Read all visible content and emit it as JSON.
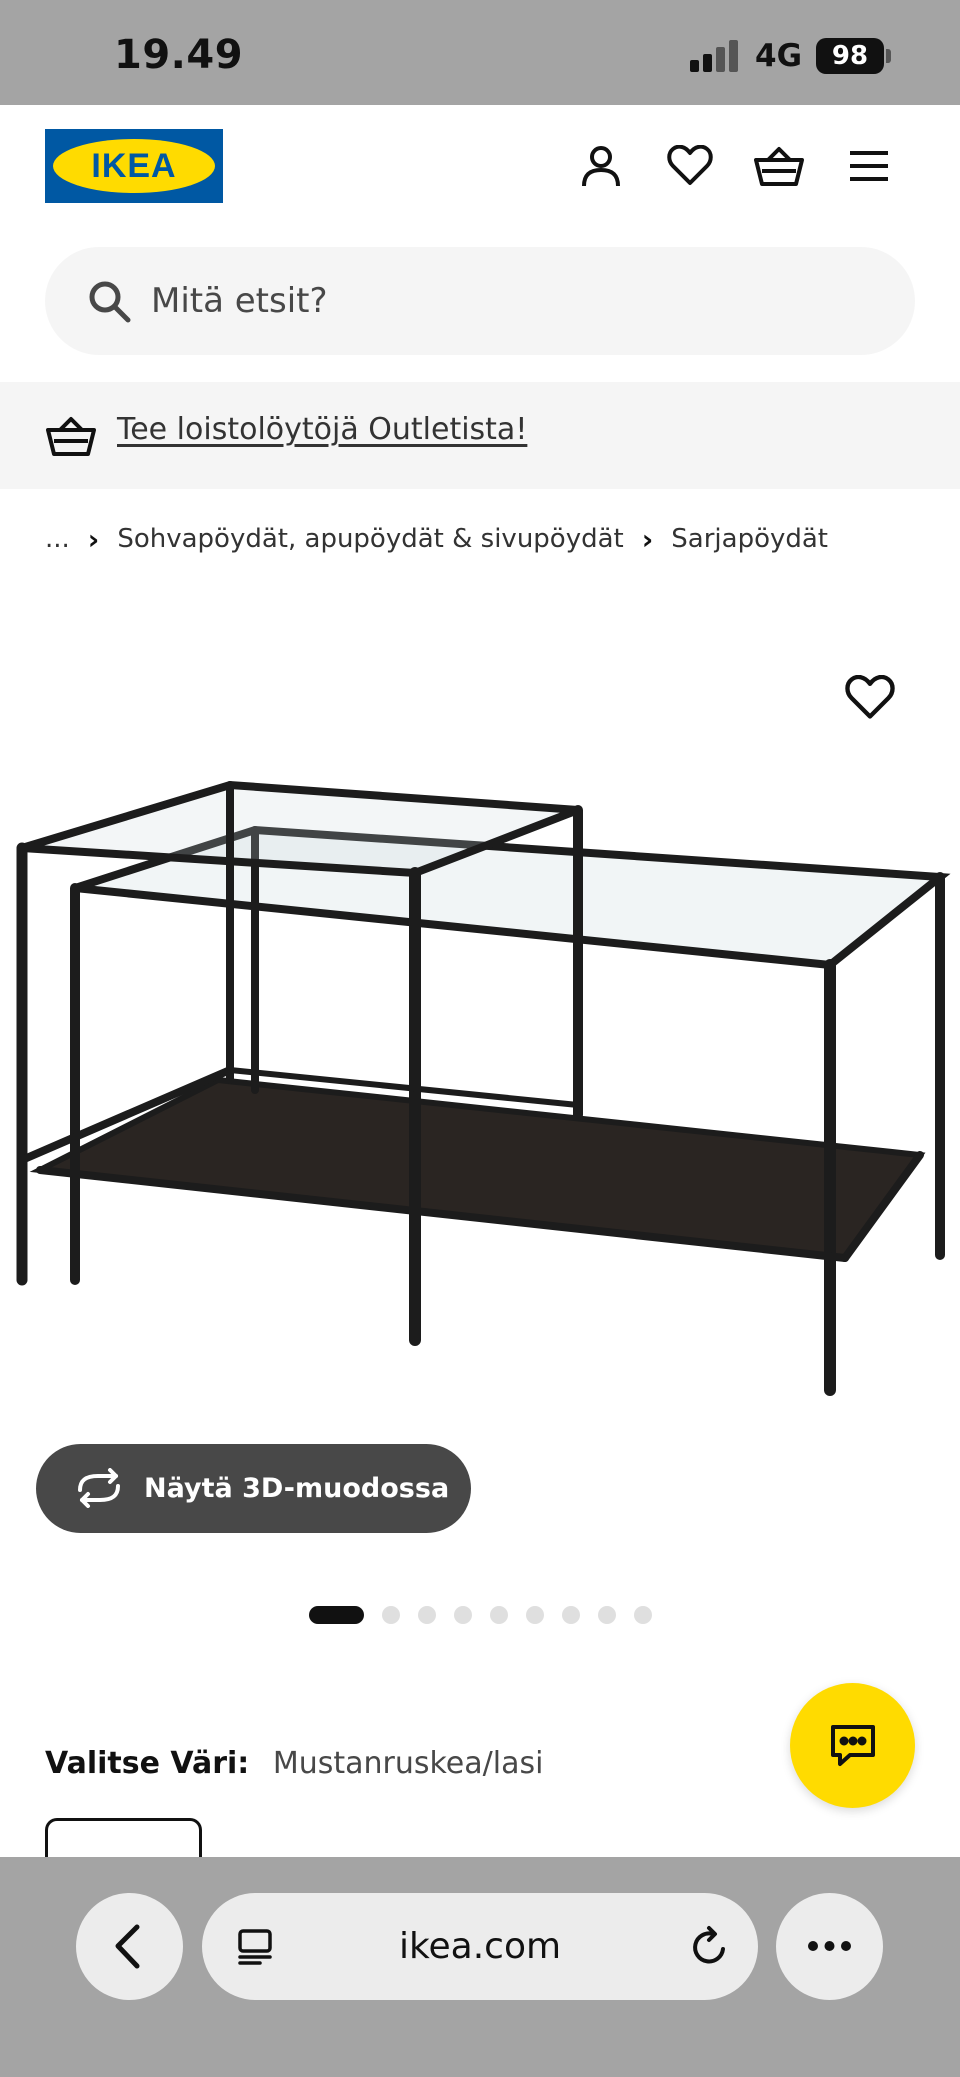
{
  "status_bar": {
    "time": "19.49",
    "network": "4G",
    "battery": "98"
  },
  "header": {
    "logo_text": "IKEA",
    "icons": [
      "user-icon",
      "heart-icon",
      "basket-icon",
      "menu-icon"
    ]
  },
  "search": {
    "placeholder": "Mitä etsit?"
  },
  "promo": {
    "link_text": "Tee loistolöytöjä Outletista!"
  },
  "breadcrumb": {
    "items": [
      "...",
      "Sohvapöydät, apupöydät & sivupöydät",
      "Sarjapöydät"
    ]
  },
  "product": {
    "view_3d_label": "Näytä 3D-muodossa",
    "image_count": 9,
    "active_image": 1,
    "color_label": "Valitse Väri:",
    "color_value": "Mustanruskea/lasi"
  },
  "browser": {
    "url": "ikea.com"
  },
  "colors": {
    "ikea_blue": "#0058a3",
    "ikea_yellow": "#ffdb00",
    "frame": "#1c1c1c",
    "shelf": "#2a2522"
  }
}
